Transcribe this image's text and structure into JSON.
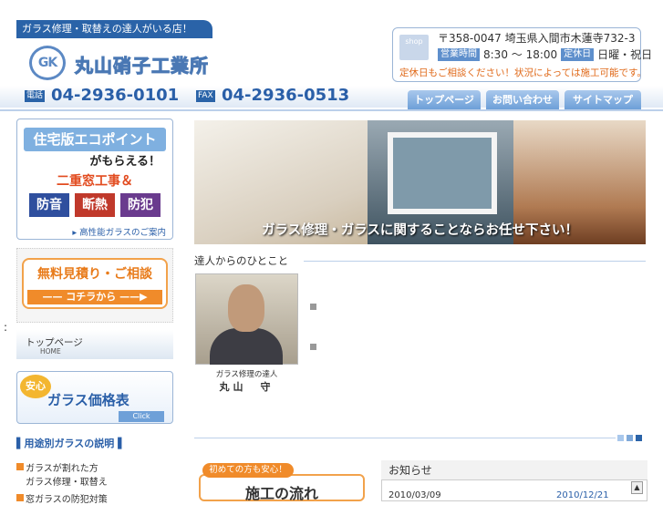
{
  "header": {
    "tagline": "ガラス修理・取替えの達人がいる店！",
    "logo_mark": "GK",
    "company": "丸山硝子工業所",
    "shop_icon": "shop",
    "address": "〒358-0047 埼玉県入間市木蓮寺732-3",
    "hours_label": "営業時間",
    "hours": "8:30 〜 18:00",
    "closed_label": "定休日",
    "closed": "日曜・祝日",
    "notice": "定休日もご相談ください！状況によっては施工可能です。",
    "tel_label": "電話",
    "tel": "04-2936-0101",
    "fax_label": "FAX",
    "fax": "04-2936-0513"
  },
  "nav": [
    {
      "label": "トップページ"
    },
    {
      "label": "お問い合わせ"
    },
    {
      "label": "サイトマップ"
    }
  ],
  "sidebar": {
    "eco_title": "住宅版エコポイント",
    "eco_sub": "がもらえる！",
    "eco_work": "二重窓工事＆",
    "eco_chips": [
      "防音",
      "断熱",
      "防犯"
    ],
    "eco_link": "▸ 高性能ガラスのご案内",
    "estimate_title": "無料見積り・ご相談",
    "estimate_arrow": "—— コチラから ——▶",
    "top_link": "トップページ",
    "top_link_en": "HOME",
    "price_anshin": "安心",
    "price_title": "ガラス価格表",
    "price_click": "Click",
    "uses_head": "用途別ガラスの説明",
    "uses": [
      {
        "line1": "ガラスが割れた方",
        "line2": "ガラス修理・取替え"
      },
      {
        "line1": "窓ガラスの防犯対策",
        "line2": ""
      }
    ]
  },
  "main": {
    "hero_caption": "ガラス修理・ガラスに関することならお任せ下さい！",
    "message_head": "達人からのひとこと",
    "caption_role": "ガラス修理の達人",
    "caption_name": "丸山　守",
    "first_time": "初めての方も安心！",
    "flow_title": "施工の流れ",
    "news_head": "お知らせ",
    "news_dates": [
      "2010/03/09",
      "2010/12/21"
    ]
  },
  "colors": {
    "brand_blue": "#2a63a8",
    "accent_orange": "#f08b2a",
    "light_blue": "#bcd0ea"
  },
  "misc": {
    "colon": ":"
  }
}
